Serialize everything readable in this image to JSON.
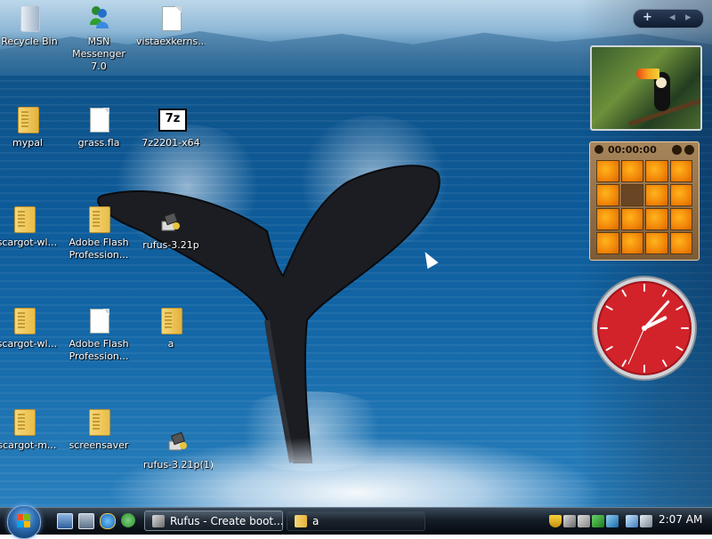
{
  "desktop": {
    "icons": [
      {
        "label": "Recycle Bin",
        "icon": "recycle-bin-icon"
      },
      {
        "label": "MSN\nMessenger 7.0",
        "icon": "msn-messenger-icon"
      },
      {
        "label": "vistaexkerns...",
        "icon": "document-icon"
      },
      {
        "label": "mypal",
        "icon": "folder-icon"
      },
      {
        "label": "grass.fla",
        "icon": "document-icon"
      },
      {
        "label": "7z2201-x64",
        "icon": "7zip-icon"
      },
      {
        "label": "escargot-wl...",
        "icon": "zip-folder-icon"
      },
      {
        "label": "Adobe Flash\nProfession...",
        "icon": "folder-icon"
      },
      {
        "label": "rufus-3.21p",
        "icon": "rufus-icon"
      },
      {
        "label": "escargot-wl...",
        "icon": "zip-folder-icon"
      },
      {
        "label": "Adobe Flash\nProfession...",
        "icon": "document-icon"
      },
      {
        "label": "a",
        "icon": "folder-icon"
      },
      {
        "label": "escargot-m...",
        "icon": "zip-folder-icon"
      },
      {
        "label": "screensaver",
        "icon": "folder-icon"
      },
      {
        "label": "rufus-3.21p(1)",
        "icon": "rufus-icon"
      }
    ]
  },
  "sidebar": {
    "add_glyph": "+",
    "prev_glyph": "◂",
    "next_glyph": "▸",
    "puzzle_time": "00:00:00",
    "clock": {
      "hour": 2,
      "minute": 7,
      "second": 34
    }
  },
  "taskbar": {
    "tasks": [
      {
        "label": "Rufus - Create boot..."
      },
      {
        "label": "a"
      }
    ],
    "time": "2:07 AM"
  }
}
